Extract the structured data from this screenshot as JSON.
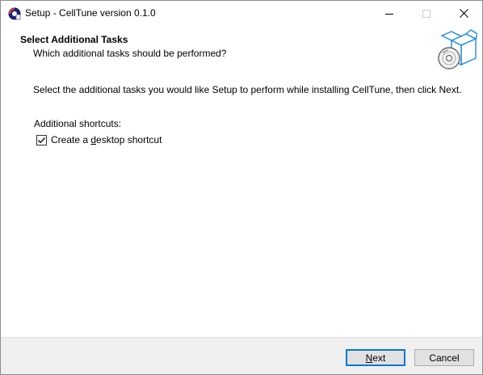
{
  "window": {
    "title": "Setup - CellTune version 0.1.0"
  },
  "header": {
    "title": "Select Additional Tasks",
    "subtitle": "Which additional tasks should be performed?"
  },
  "content": {
    "description": "Select the additional tasks you would like Setup to perform while installing CellTune, then click Next.",
    "group_label": "Additional shortcuts:",
    "tasks": [
      {
        "label_pre": "Create a ",
        "label_accel": "d",
        "label_post": "esktop shortcut",
        "checked": true
      }
    ]
  },
  "footer": {
    "next_accel": "N",
    "next_rest": "ext",
    "cancel_label": "Cancel"
  },
  "icons": {
    "app": "setup-app-icon",
    "header": "install-box-disc-icon",
    "minimize": "minimize-icon",
    "maximize": "maximize-icon",
    "close": "close-icon",
    "check": "checkmark-icon"
  }
}
